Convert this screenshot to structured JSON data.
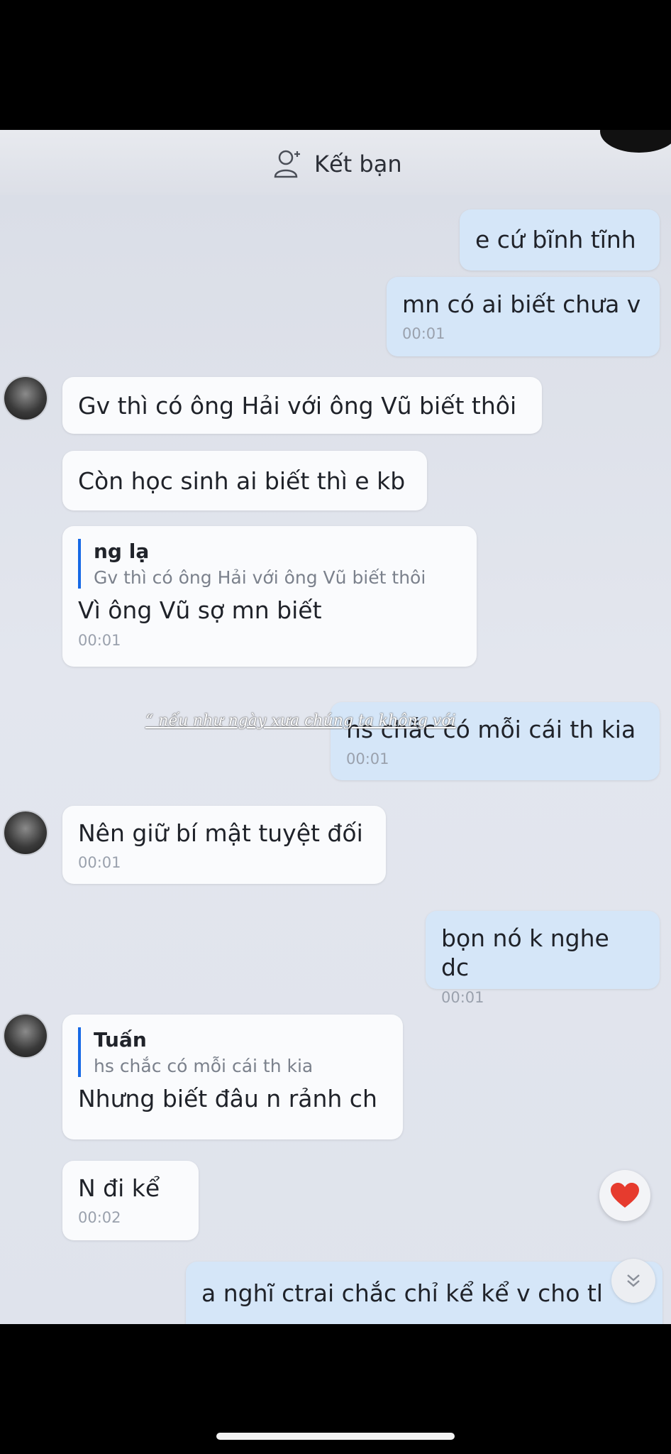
{
  "header": {
    "add_friend_label": "Kết bạn",
    "add_friend_icon": "add-friend-icon"
  },
  "messages": [
    {
      "dir": "out",
      "text": "e cứ bĩnh tĩnh",
      "time": ""
    },
    {
      "dir": "out",
      "text": "mn có ai biết chưa v",
      "time": "00:01"
    },
    {
      "dir": "in",
      "text": "Gv thì có ông Hải với ông Vũ biết thôi",
      "time": ""
    },
    {
      "dir": "in",
      "text": "Còn học sinh ai biết thì e kb",
      "time": ""
    },
    {
      "dir": "in",
      "quote_name": "ng lạ",
      "quote_text": "Gv thì có ông Hải với ông Vũ biết thôi",
      "text": "Vì ông Vũ sợ mn biết",
      "time": "00:01"
    },
    {
      "dir": "out",
      "text": "hs chắc có mỗi cái th kia",
      "time": "00:01"
    },
    {
      "dir": "in",
      "text": "Nên giữ bí mật tuyệt đối",
      "time": "00:01"
    },
    {
      "dir": "out",
      "text": "bọn nó k nghe dc",
      "time": "00:01"
    },
    {
      "dir": "in",
      "quote_name": "Tuấn",
      "quote_text": "hs chắc có mỗi cái th kia",
      "text": "Nhưng biết đâu n rảnh ch",
      "time": ""
    },
    {
      "dir": "in",
      "text": "N đi kể",
      "time": "00:02"
    },
    {
      "dir": "out",
      "text": "a nghĩ ctrai chắc chỉ kể kể v cho tl",
      "time": ""
    }
  ],
  "overlay": {
    "watermark_text": "“ nếu như ngày xưa chúng ta không với"
  },
  "reactions": {
    "heart_icon": "heart-icon",
    "heart_color": "#e63b2e"
  },
  "scroll": {
    "icon": "double-chevron-down-icon"
  }
}
